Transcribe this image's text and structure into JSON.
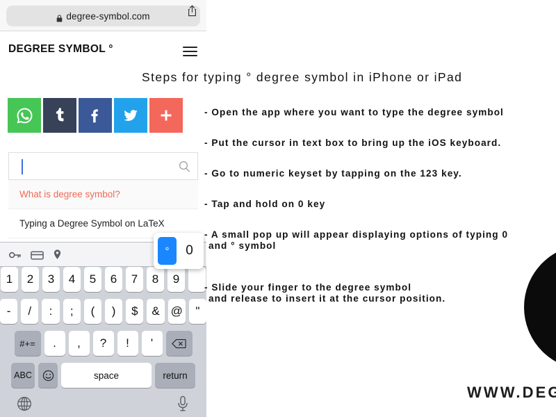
{
  "browser": {
    "url": "degree-symbol.com",
    "lock_icon": "lock-icon",
    "share_icon": "share-icon"
  },
  "site_header": {
    "title": "DEGREE SYMBOL °",
    "menu_icon": "hamburger-menu-icon"
  },
  "social_buttons": [
    {
      "name": "whatsapp",
      "glyph": "whatsapp-icon",
      "color": "#45c655"
    },
    {
      "name": "tumblr",
      "glyph": "tumblr-icon",
      "color": "#374157"
    },
    {
      "name": "facebook",
      "glyph": "facebook-icon",
      "color": "#3b5998"
    },
    {
      "name": "twitter",
      "glyph": "twitter-icon",
      "color": "#23a2ec"
    },
    {
      "name": "addthis-more",
      "glyph": "plus-icon",
      "color": "#f4675b"
    }
  ],
  "search": {
    "value": "",
    "placeholder": "",
    "icon": "search-icon",
    "suggestions": [
      {
        "label": "What is degree symbol?",
        "highlighted": true
      },
      {
        "label": "Typing a Degree Symbol on LaTeX",
        "highlighted": false
      }
    ]
  },
  "keyboard": {
    "toolbar_icons": [
      "key-icon",
      "credit-card-icon",
      "location-pin-icon"
    ],
    "collapse_icon": "chevron-up-icon",
    "popup": {
      "selected": "°",
      "alternate": "0"
    },
    "row1": [
      "1",
      "2",
      "3",
      "4",
      "5",
      "6",
      "7",
      "8",
      "9"
    ],
    "row2": [
      "-",
      "/",
      ":",
      ";",
      "(",
      ")",
      "$",
      "&",
      "@",
      "\""
    ],
    "row3_fn": "#+=",
    "row3": [
      ".",
      ",",
      "?",
      "!",
      "'"
    ],
    "delete_icon": "delete-key-icon",
    "row4": {
      "abc": "ABC",
      "emoji": "emoji-icon",
      "space": "space",
      "return": "return"
    },
    "bottom": {
      "globe": "globe-icon",
      "mic": "microphone-icon"
    }
  },
  "instructions": {
    "headline": "Steps for typing ° degree symbol in iPhone or iPad",
    "steps": [
      {
        "line1": "- Open the app where you want to type the degree symbol",
        "line2": ""
      },
      {
        "line1": "- Put the cursor in text box to bring up the iOS keyboard.",
        "line2": ""
      },
      {
        "line1": "- Go to numeric keyset by tapping on the 123 key.",
        "line2": ""
      },
      {
        "line1": "- Tap and hold on 0 key",
        "line2": ""
      },
      {
        "line1": "- A small pop up will appear displaying options of typing 0",
        "line2": "and ° symbol"
      },
      {
        "line1": "- Slide your finger to the degree symbol",
        "line2": "and release to insert it at the cursor position."
      }
    ]
  },
  "graphic": {
    "ring_icon": "degree-symbol-ring",
    "ring_color": "#0b0b0b"
  },
  "brand": {
    "text": "WWW.DEGREE-SYMBOL.COM"
  }
}
